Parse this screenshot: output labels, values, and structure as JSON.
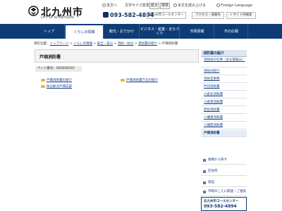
{
  "header": {
    "logo_title": "北九州市",
    "logo_subtitle": "CITY OF KITAKYUSHU",
    "util_home": "本文へ",
    "util_fontsize_label": "文字サイズ変更",
    "fontsize_large": "拡大",
    "fontsize_standard": "標準",
    "util_speech": "本文を読み上げる",
    "util_language": "Foreign Language",
    "phone": "093-582-4894",
    "call_center": "北九州市コールセンター",
    "access_button": "アクセス・道路先",
    "site_search_button": "サイト内検索"
  },
  "nav": {
    "items": [
      {
        "label": "トップ"
      },
      {
        "label": "くらしの情報"
      },
      {
        "label": "観光・おでかけ"
      },
      {
        "label": "ビジネス・産業・まちづくり"
      },
      {
        "label": "市政情報"
      },
      {
        "label": "市の広報"
      }
    ]
  },
  "breadcrumb": {
    "prefix": "現在位置：",
    "items": [
      "トップページ",
      "くらしの情報",
      "安全・安心",
      "消防・防災",
      "消防署の紹介"
    ],
    "current": "戸畑消防署",
    "sep": ">"
  },
  "main": {
    "page_title": "戸畑消防署",
    "page_id": "ページ番号：000008302",
    "links": [
      "戸畑消防署の紹介",
      "戸畑消防署庁舎の紹介",
      "防災拠点戸畑支部"
    ]
  },
  "sidebar": {
    "heading": "消防署の紹介",
    "items": [
      {
        "label": "消防局の仕事（主な取組み）"
      },
      {
        "label": "消防の紹介"
      },
      {
        "label": "消防音楽隊"
      },
      {
        "label": "門司消防署"
      },
      {
        "label": "小倉北消防署"
      },
      {
        "label": "小倉南消防署"
      },
      {
        "label": "若松消防署"
      },
      {
        "label": "八幡東消防署"
      },
      {
        "label": "八幡西消防署"
      },
      {
        "label": "戸畑消防署"
      }
    ],
    "blocks": [
      {
        "label": "組織から探す"
      },
      {
        "label": "区役所"
      },
      {
        "label": "施設"
      },
      {
        "label": "市政のこえに関連・ご相談"
      }
    ],
    "call_center_label": "北九州市コールセンター",
    "call_center_phone": "093-582-4894"
  },
  "colors": {
    "nav_bg": "#0e3c76",
    "link": "#1a3f8a",
    "folder": "#e8b93c"
  }
}
